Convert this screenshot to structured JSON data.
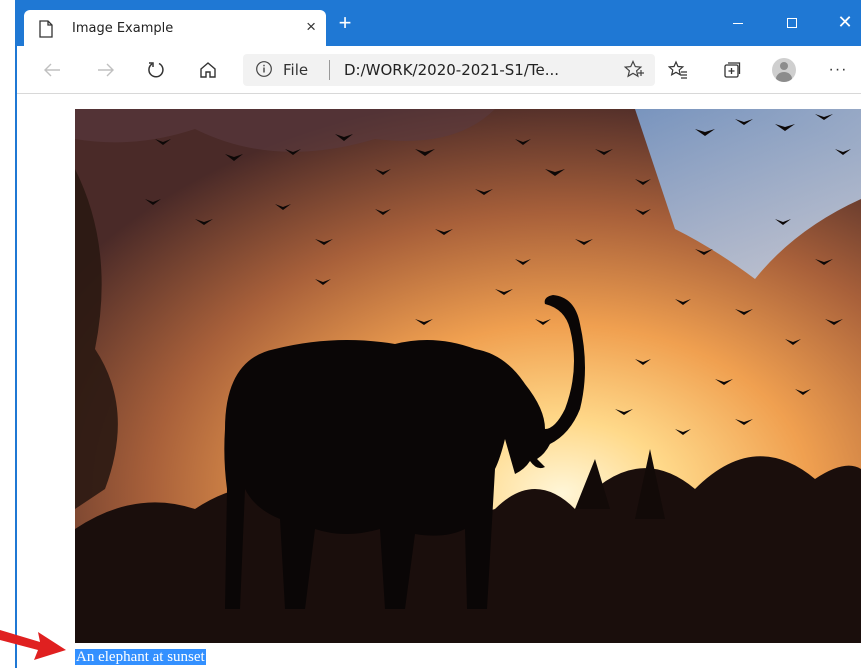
{
  "tab": {
    "title": "Image Example",
    "close": "×"
  },
  "new_tab": "+",
  "window_controls": {
    "minimize": "minimize",
    "maximize": "maximize",
    "close": "✕"
  },
  "address": {
    "scheme_label": "File",
    "url": "D:/WORK/2020-2021-S1/Te..."
  },
  "toolbar": {
    "more": "···"
  },
  "page": {
    "image_alt": "elephant at sunset with birds",
    "caption": "An elephant at sunset"
  },
  "colors": {
    "titlebar": "#1f78d4",
    "selection": "#3390ff",
    "arrow": "#e02020"
  }
}
